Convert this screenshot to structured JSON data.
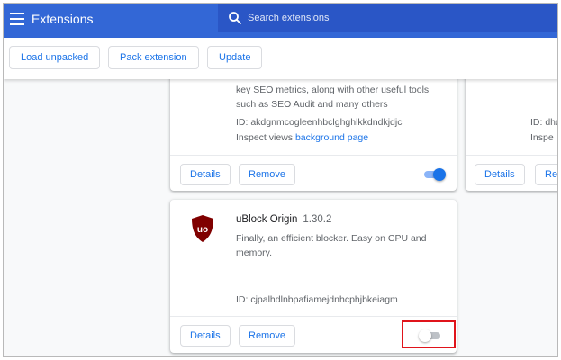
{
  "header": {
    "title": "Extensions",
    "search_placeholder": "Search extensions"
  },
  "toolbar": {
    "load_unpacked": "Load unpacked",
    "pack_extension": "Pack extension",
    "update": "Update"
  },
  "cards": {
    "top": {
      "desc_line1": "key SEO metrics, along with other useful tools",
      "desc_line2": "such as SEO Audit and many others",
      "id": "ID: akdgnmcogleenhbclghghlkkdndkjdjc",
      "inspect_label": "Inspect views",
      "inspect_link": "background page",
      "details": "Details",
      "remove": "Remove",
      "enabled": true
    },
    "right": {
      "id": "ID: dhd",
      "inspect": "Inspe",
      "details": "Details",
      "remove": "Rem"
    },
    "ublock": {
      "name": "uBlock Origin",
      "version": "1.30.2",
      "desc_line1": "Finally, an efficient blocker. Easy on CPU and",
      "desc_line2": "memory.",
      "id": "ID: cjpalhdlnbpafiamejdnhcphjbkeiagm",
      "logo_text": "uo",
      "details": "Details",
      "remove": "Remove",
      "enabled": false
    }
  },
  "colors": {
    "header_bg": "#3367d6",
    "search_bg": "#2a56c6",
    "accent": "#1a73e8",
    "highlight": "#e0141b",
    "ublock_red": "#800000"
  }
}
